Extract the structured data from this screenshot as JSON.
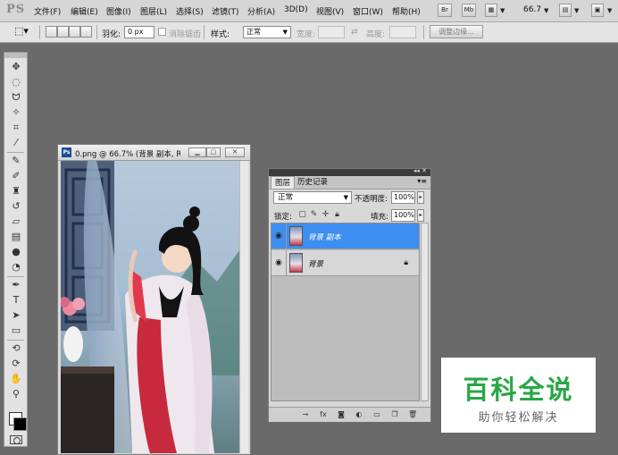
{
  "app": {
    "logo": "PS"
  },
  "menu": [
    {
      "label": "文件(F)"
    },
    {
      "label": "编辑(E)"
    },
    {
      "label": "图像(I)"
    },
    {
      "label": "图层(L)"
    },
    {
      "label": "选择(S)"
    },
    {
      "label": "滤镜(T)"
    },
    {
      "label": "分析(A)"
    },
    {
      "label": "3D(D)"
    },
    {
      "label": "视图(V)"
    },
    {
      "label": "窗口(W)"
    },
    {
      "label": "帮助(H)"
    }
  ],
  "menubar_buttons": {
    "br": "Br",
    "mb": "Mb"
  },
  "zoom": "66.7",
  "options": {
    "feather_label": "羽化:",
    "feather_value": "0 px",
    "antialias_label": "消除锯齿",
    "style_label": "样式:",
    "style_value": "正常",
    "width_label": "宽度:",
    "height_label": "高度:",
    "refine_label": "调整边缘..."
  },
  "document": {
    "title": "0.png @ 66.7% (背景 副本, R...",
    "ps_badge": "Ps"
  },
  "layers_panel": {
    "tabs": [
      {
        "label": "图层"
      },
      {
        "label": "历史记录"
      }
    ],
    "blend_mode": "正常",
    "opacity_label": "不透明度:",
    "opacity_value": "100%",
    "lock_label": "锁定:",
    "fill_label": "填充:",
    "fill_value": "100%",
    "layers": [
      {
        "name": "背景 副本",
        "selected": true
      },
      {
        "name": "背景",
        "locked": true
      }
    ]
  },
  "watermark": {
    "title": "百科全说",
    "subtitle": "助你轻松解决"
  },
  "colors": {
    "selection": "#3c8ef0",
    "watermark_green": "#28a745",
    "foreground": "#ffffff",
    "background": "#000000"
  }
}
